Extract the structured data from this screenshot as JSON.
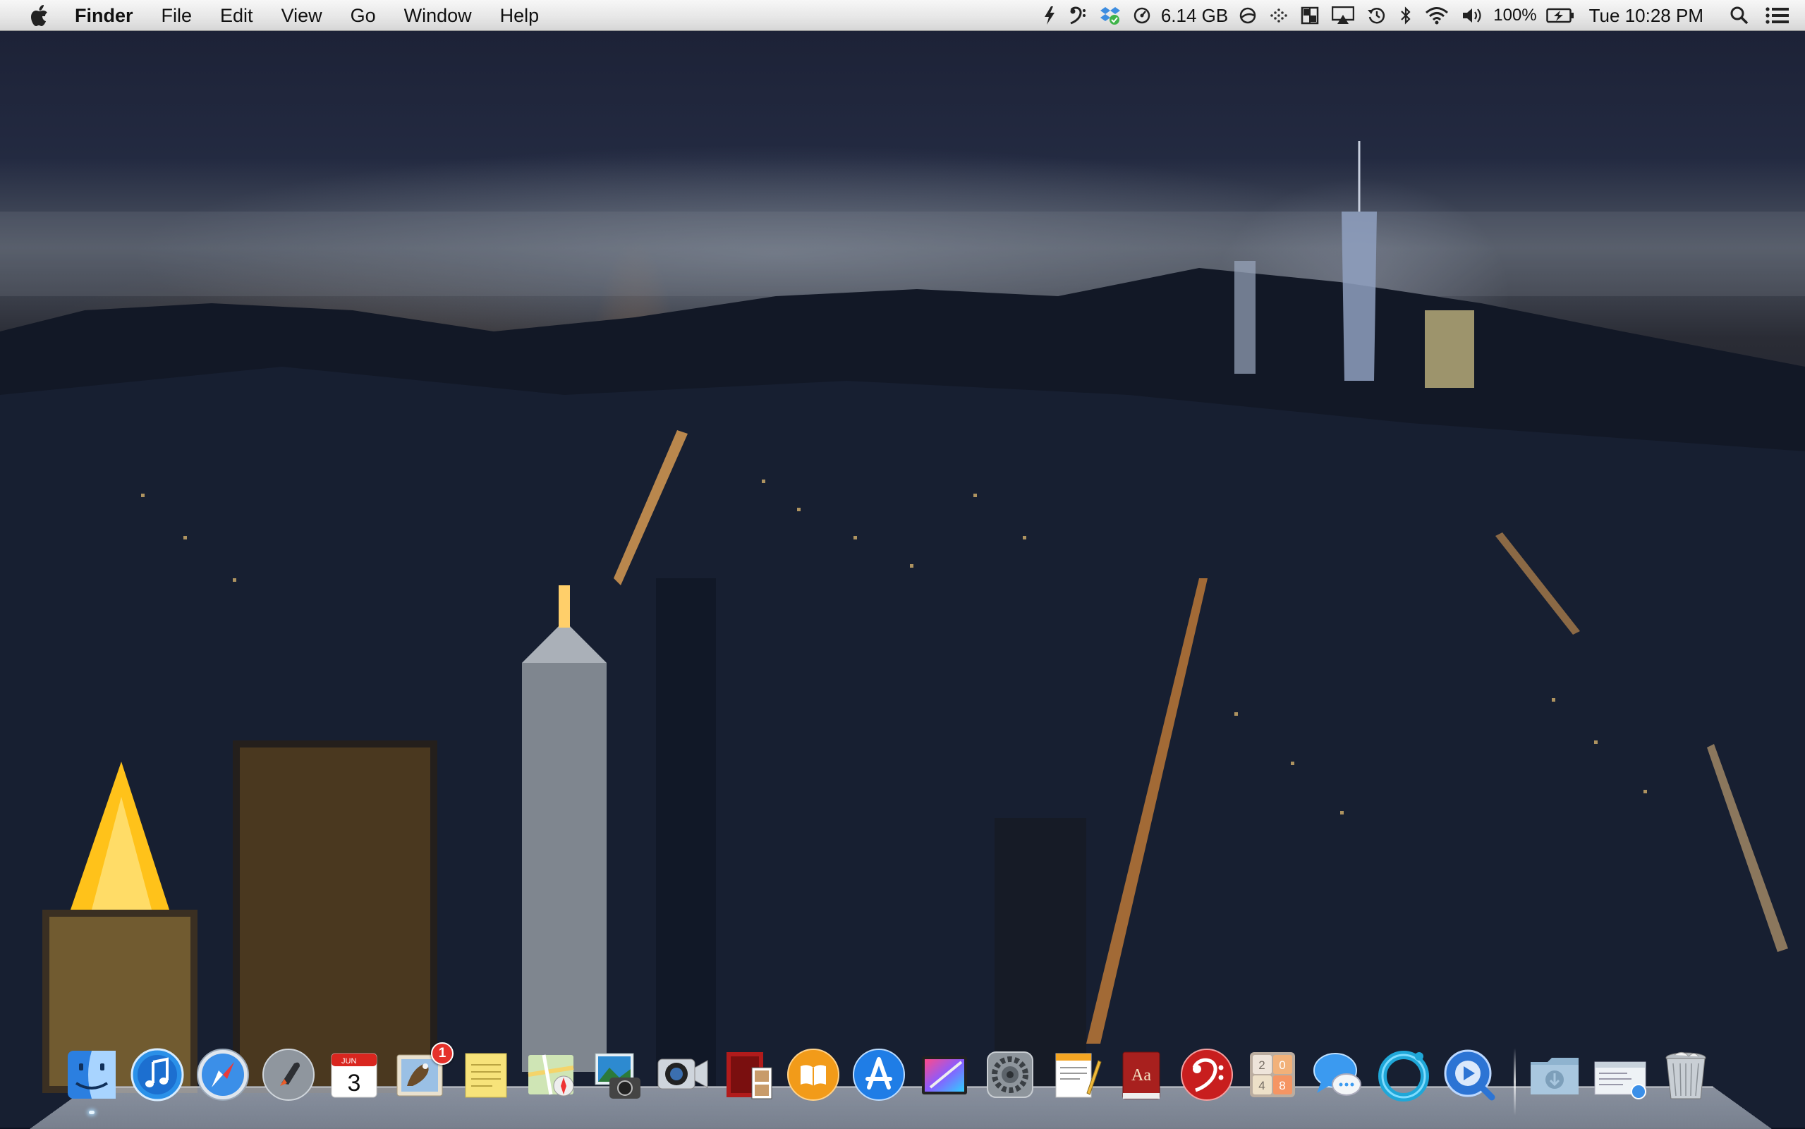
{
  "menubar": {
    "app_name": "Finder",
    "menus": [
      "File",
      "Edit",
      "View",
      "Go",
      "Window",
      "Help"
    ],
    "status": {
      "memory": "6.14 GB",
      "battery": "100%",
      "clock": "Tue 10:28 PM"
    }
  },
  "dock": {
    "apps": [
      {
        "name": "Finder",
        "icon": "finder-icon",
        "running": true
      },
      {
        "name": "iTunes",
        "icon": "itunes-icon",
        "running": false
      },
      {
        "name": "Safari",
        "icon": "safari-icon",
        "running": false
      },
      {
        "name": "Launchpad",
        "icon": "launchpad-icon",
        "running": false
      },
      {
        "name": "Calendar",
        "icon": "calendar-icon",
        "running": false,
        "month": "JUN",
        "day": "3"
      },
      {
        "name": "Mail",
        "icon": "mail-icon",
        "running": false,
        "badge": "1"
      },
      {
        "name": "Stickies",
        "icon": "stickies-icon",
        "running": false
      },
      {
        "name": "Maps",
        "icon": "maps-icon",
        "running": false
      },
      {
        "name": "Image Capture",
        "icon": "image-capture-icon",
        "running": false
      },
      {
        "name": "FaceTime",
        "icon": "facetime-icon",
        "running": false
      },
      {
        "name": "Photo Booth",
        "icon": "photo-booth-icon",
        "running": false
      },
      {
        "name": "iBooks",
        "icon": "ibooks-icon",
        "running": false
      },
      {
        "name": "App Store",
        "icon": "app-store-icon",
        "running": false
      },
      {
        "name": "Final Cut Pro",
        "icon": "final-cut-icon",
        "running": false
      },
      {
        "name": "System Preferences",
        "icon": "system-preferences-icon",
        "running": false
      },
      {
        "name": "Pages",
        "icon": "pages-icon",
        "running": false
      },
      {
        "name": "Dictionary",
        "icon": "dictionary-icon",
        "running": false,
        "label": "Aa"
      },
      {
        "name": "Capo",
        "icon": "bass-clef-icon",
        "running": false
      },
      {
        "name": "2048",
        "icon": "2048-icon",
        "running": false,
        "tiles": [
          "2",
          "0",
          "4",
          "8"
        ]
      },
      {
        "name": "Messages",
        "icon": "messages-icon",
        "running": false
      },
      {
        "name": "Tweetbot",
        "icon": "ring-app-icon",
        "running": false
      },
      {
        "name": "QuickTime Player",
        "icon": "quicktime-icon",
        "running": false
      }
    ],
    "stacks": [
      {
        "name": "Downloads",
        "icon": "downloads-folder-icon"
      },
      {
        "name": "Documents",
        "icon": "documents-stack-icon"
      },
      {
        "name": "Trash",
        "icon": "trash-icon"
      }
    ]
  }
}
